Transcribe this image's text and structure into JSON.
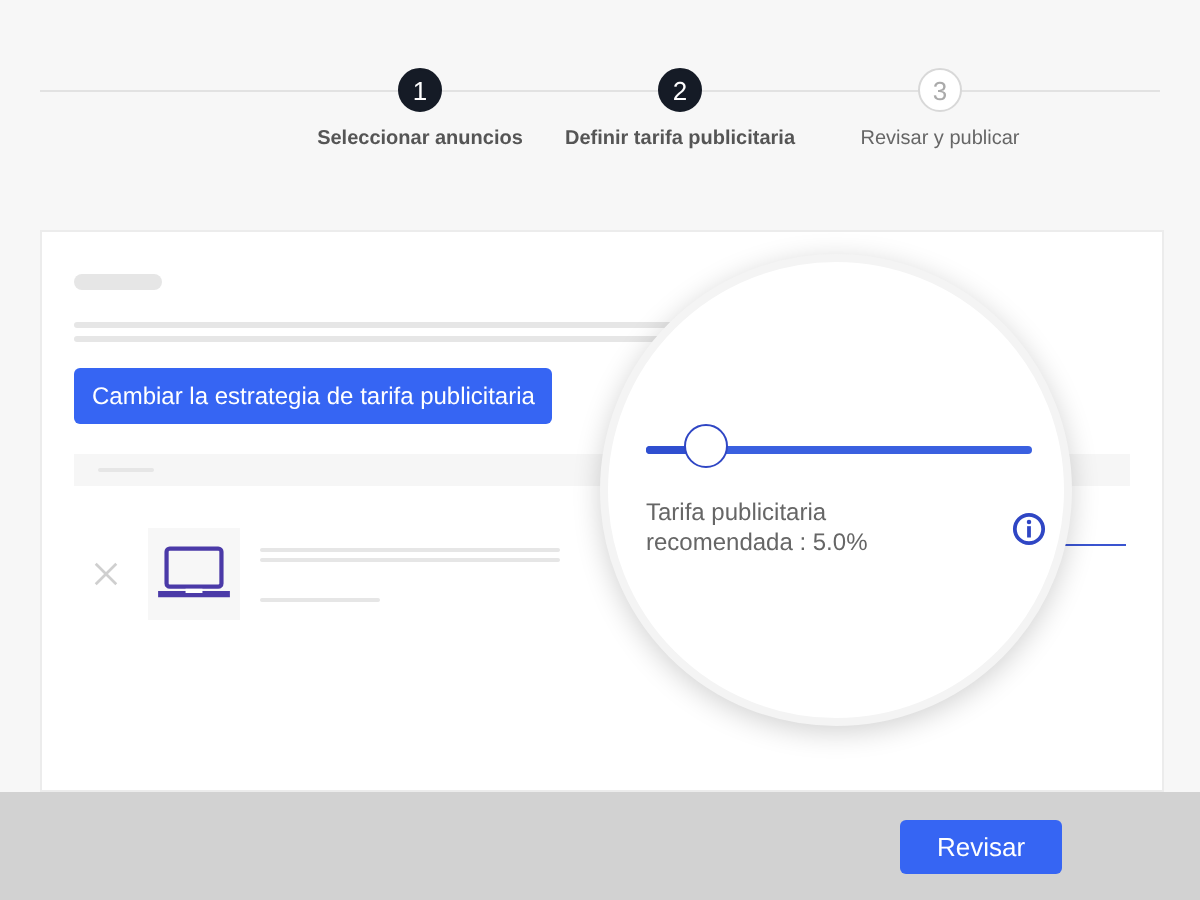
{
  "steps": [
    {
      "number": "1",
      "label": "Seleccionar anuncios",
      "active": true
    },
    {
      "number": "2",
      "label": "Definir tarifa publicitaria",
      "active": true
    },
    {
      "number": "3",
      "label": "Revisar y publicar",
      "active": false
    }
  ],
  "card": {
    "button": "Cambiar la estrategia de tarifa publicitaria"
  },
  "magnifier": {
    "slider": {
      "level": 0.155
    },
    "caption": "Tarifa publicitaria recomendada : 5.0%"
  },
  "footer": {
    "button": "Revisar"
  }
}
